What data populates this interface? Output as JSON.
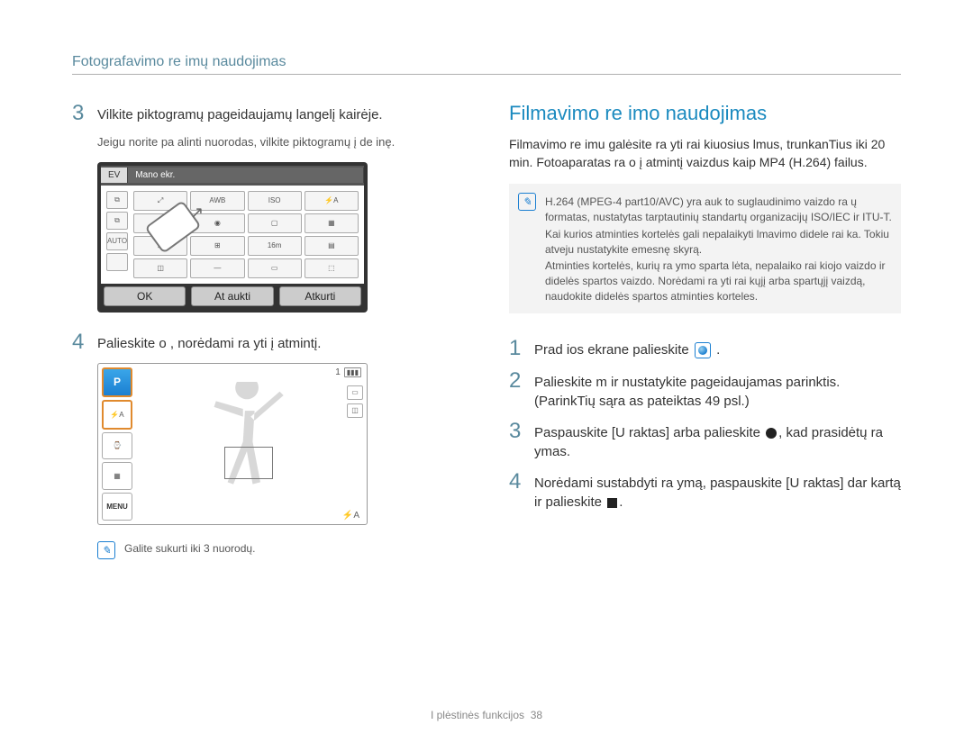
{
  "header": {
    "title": "Fotografavimo re imų naudojimas"
  },
  "left": {
    "step3": {
      "num": "3",
      "text": "Vilkite piktogramų pageidaujamų langelį kairėje.",
      "sub": "Jeigu norite pa alinti nuorodas, vilkite piktogramų į de inę."
    },
    "screen1": {
      "tabs": [
        "EV",
        "Mano ekr."
      ],
      "left_icons": [
        "⧉",
        "⧉",
        "AUTO",
        ""
      ],
      "grid": [
        [
          "⤢",
          "AWB",
          "ISO",
          "⚡A"
        ],
        [
          "☺",
          "◉",
          "▢",
          "▦"
        ],
        [
          "⊡",
          "⊞",
          "16m",
          "▤"
        ],
        [
          "◫",
          "—",
          "▭",
          "⬚"
        ]
      ],
      "buttons": [
        "OK",
        "At aukti",
        "Atkurti"
      ]
    },
    "step4": {
      "num": "4",
      "text": "Palieskite o , norėdami ra yti į atmintį."
    },
    "screen2": {
      "top": {
        "count": "1",
        "batt": "▮▮▮"
      },
      "left_buttons": [
        "P",
        "⚡A",
        "⌚",
        "▦",
        "MENU"
      ],
      "right_icons": [
        "▭",
        "◫"
      ],
      "bottom": "⚡A"
    },
    "note": "Galite sukurti iki 3 nuorodų."
  },
  "right": {
    "title": "Filmavimo re imo naudojimas",
    "para": "Filmavimo re imu galėsite ra yti rai kiuosius lmus, trunkanTius iki 20 min. Fotoaparatas ra o į atmintį vaizdus kaip MP4 (H.264) failus.",
    "info": {
      "l1": "H.264 (MPEG-4 part10/AVC) yra auk to suglaudinimo vaizdo ra ų formatas, nustatytas tarptautinių standartų organizacijų ISO/IEC ir ITU-T.",
      "l2": "Kai kurios atminties kortelės gali nepalaikyti lmavimo didele rai ka. Tokiu atveju nustatykite emesnę skyrą.",
      "l3": "Atminties kortelės, kurių ra ymo sparta lėta, nepalaiko rai kiojo vaizdo ir didelės spartos vaizdo. Norėdami ra yti rai kųjį arba spartųjį vaizdą, naudokite didelės spartos atminties korteles."
    },
    "steps": {
      "s1": {
        "num": "1",
        "text_a": "Prad ios ekrane palieskite ",
        "text_b": "."
      },
      "s2": {
        "num": "2",
        "text": "Palieskite m  ir nustatykite pageidaujamas parinktis. (ParinkTių sąra as pateiktas 49 psl.)"
      },
      "s3": {
        "num": "3",
        "text_a": "Paspauskite [U raktas] arba palieskite ",
        "text_b": ", kad prasidėtų ra ymas."
      },
      "s4": {
        "num": "4",
        "text_a": "Norėdami sustabdyti ra ymą, paspauskite [U raktas] dar kartą ir palieskite ",
        "text_b": "."
      }
    }
  },
  "footer": {
    "text": "I plėstinės funkcijos",
    "page": "38"
  }
}
